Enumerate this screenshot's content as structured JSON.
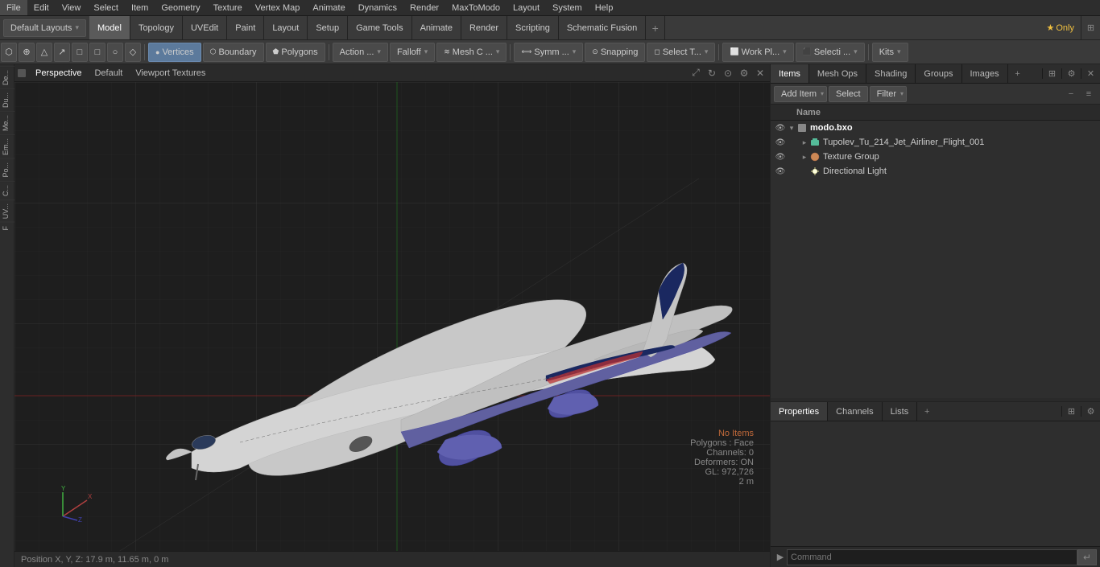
{
  "menubar": {
    "items": [
      "File",
      "Edit",
      "View",
      "Select",
      "Item",
      "Geometry",
      "Texture",
      "Vertex Map",
      "Animate",
      "Dynamics",
      "Render",
      "MaxToModo",
      "Layout",
      "System",
      "Help"
    ]
  },
  "toolbar": {
    "layout_dropdown": "Default Layouts",
    "tabs": [
      "Model",
      "Topology",
      "UVEdit",
      "Paint",
      "Layout",
      "Setup",
      "Game Tools",
      "Animate",
      "Render",
      "Scripting",
      "Schematic Fusion"
    ],
    "active_tab": "Model",
    "plus_label": "+",
    "star_label": "★ Only"
  },
  "mode_toolbar": {
    "left_buttons": [
      "⬡",
      "⊕",
      "△",
      "↗",
      "□",
      "□",
      "○",
      "⬟"
    ],
    "vertices_label": "Vertices",
    "boundary_label": "Boundary",
    "polygons_label": "Polygons",
    "action_label": "Action ...",
    "falloff_label": "Falloff",
    "mesh_c_label": "Mesh C ...",
    "symm_label": "Symm ...",
    "snapping_label": "Snapping",
    "select_t_label": "Select T...",
    "work_pl_label": "Work Pl...",
    "selecti_label": "Selecti ...",
    "kits_label": "Kits"
  },
  "viewport": {
    "indicator_color": "#555",
    "labels": [
      "Perspective",
      "Default",
      "Viewport Textures"
    ],
    "no_items_label": "No Items",
    "polygons_label": "Polygons : Face",
    "channels_label": "Channels: 0",
    "deformers_label": "Deformers: ON",
    "gl_label": "GL: 972,726",
    "scale_label": "2 m",
    "position_label": "Position X, Y, Z:   17.9 m, 11.65 m, 0 m"
  },
  "items_panel": {
    "tabs": [
      "Items",
      "Mesh Ops",
      "Shading",
      "Groups",
      "Images"
    ],
    "active_tab": "Items",
    "add_item_label": "Add Item",
    "select_label": "Select",
    "filter_label": "Filter",
    "column_header": "Name",
    "items": [
      {
        "id": "modo-bxo",
        "label": "modo.bxo",
        "level": 0,
        "type": "root",
        "visible": true,
        "expanded": true
      },
      {
        "id": "tupolev",
        "label": "Tupolev_Tu_214_Jet_Airliner_Flight_001",
        "level": 1,
        "type": "mesh",
        "visible": true,
        "expanded": false
      },
      {
        "id": "texture-group",
        "label": "Texture Group",
        "level": 1,
        "type": "texture",
        "visible": true,
        "expanded": false
      },
      {
        "id": "dir-light",
        "label": "Directional Light",
        "level": 1,
        "type": "light",
        "visible": true,
        "expanded": false
      }
    ]
  },
  "properties_panel": {
    "tabs": [
      "Properties",
      "Channels",
      "Lists"
    ],
    "active_tab": "Properties",
    "plus_label": "+"
  },
  "command_bar": {
    "placeholder": "Command",
    "arrow_label": "▶"
  },
  "sidebar_tabs": [
    "De...",
    "Du...",
    "Me...",
    "Em...",
    "Po...",
    "C...",
    "UV...",
    "F"
  ]
}
